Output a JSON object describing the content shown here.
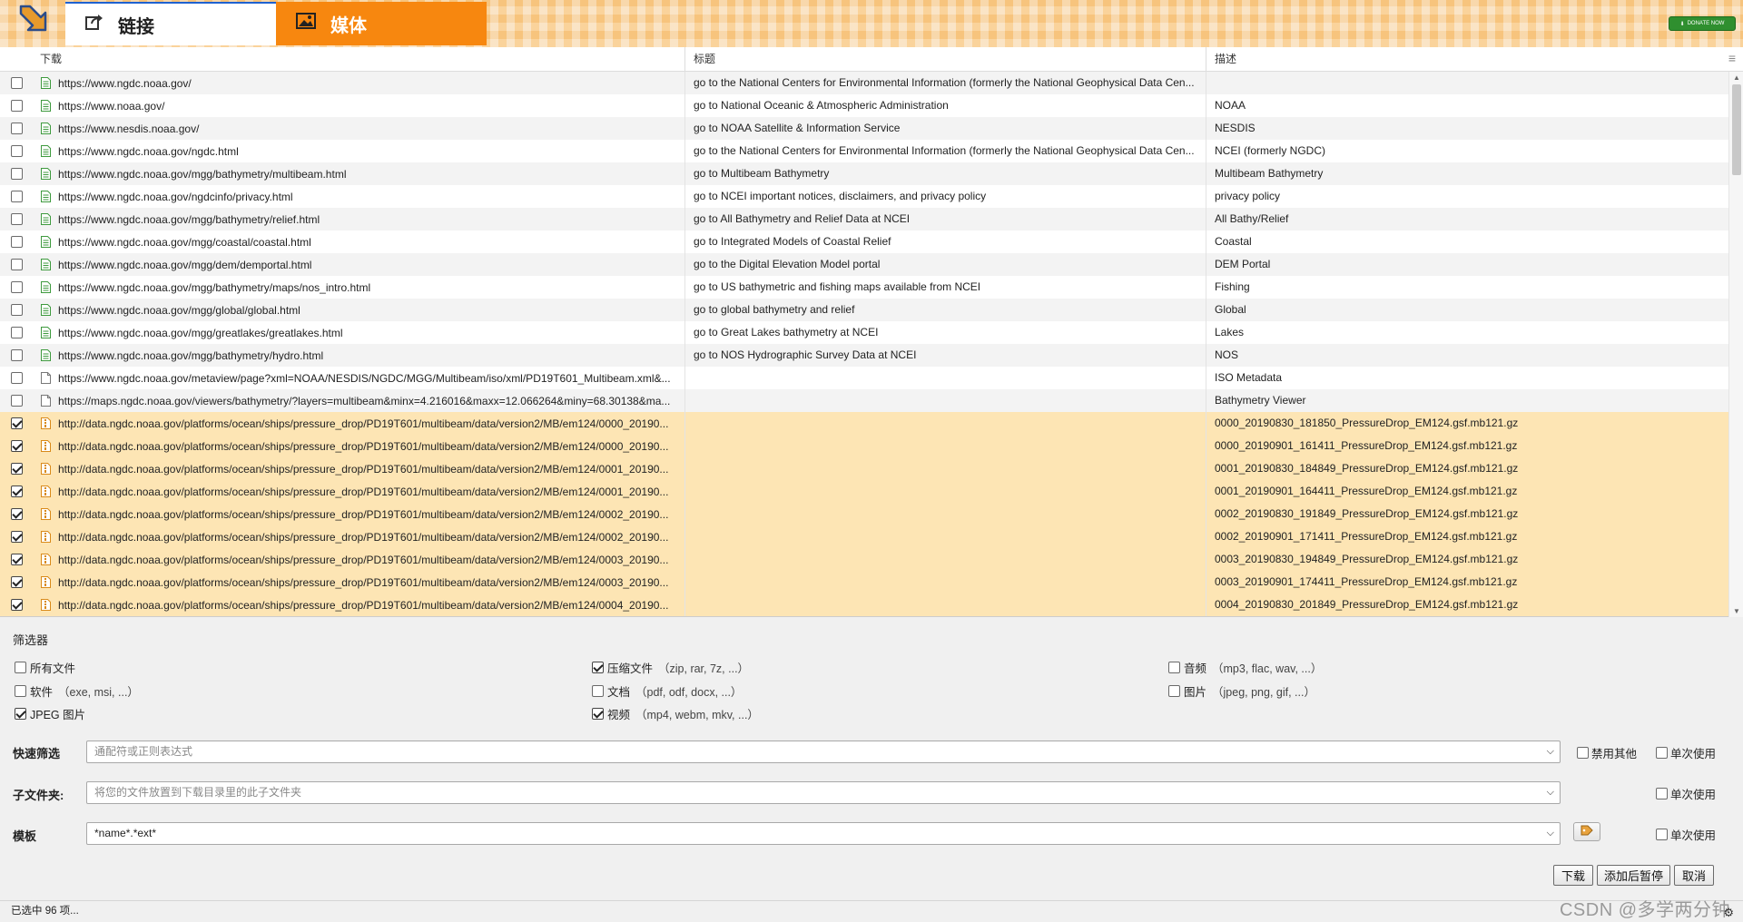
{
  "tabs": [
    {
      "label": "链接",
      "icon": "share-icon",
      "active": true
    },
    {
      "label": "媒体",
      "icon": "image-icon",
      "active": false
    }
  ],
  "donate_label": "DONATE NOW",
  "table": {
    "headers": {
      "url": "下载",
      "title": "标题",
      "desc": "描述"
    },
    "rows": [
      {
        "checked": false,
        "icon": "page-icon",
        "url": "https://www.ngdc.noaa.gov/",
        "title": "go to the National Centers for Environmental Information (formerly the National Geophysical Data Cen...",
        "desc": ""
      },
      {
        "checked": false,
        "icon": "page-icon",
        "url": "https://www.noaa.gov/",
        "title": "go to National Oceanic & Atmospheric Administration",
        "desc": "NOAA"
      },
      {
        "checked": false,
        "icon": "page-icon",
        "url": "https://www.nesdis.noaa.gov/",
        "title": "go to NOAA Satellite & Information Service",
        "desc": "NESDIS"
      },
      {
        "checked": false,
        "icon": "page-icon",
        "url": "https://www.ngdc.noaa.gov/ngdc.html",
        "title": "go to the National Centers for Environmental Information (formerly the National Geophysical Data Cen...",
        "desc": "NCEI (formerly NGDC)"
      },
      {
        "checked": false,
        "icon": "page-icon",
        "url": "https://www.ngdc.noaa.gov/mgg/bathymetry/multibeam.html",
        "title": "go to Multibeam Bathymetry",
        "desc": "Multibeam Bathymetry"
      },
      {
        "checked": false,
        "icon": "page-icon",
        "url": "https://www.ngdc.noaa.gov/ngdcinfo/privacy.html",
        "title": "go to NCEI important notices, disclaimers, and privacy policy",
        "desc": "privacy policy"
      },
      {
        "checked": false,
        "icon": "page-icon",
        "url": "https://www.ngdc.noaa.gov/mgg/bathymetry/relief.html",
        "title": "go to All Bathymetry and Relief Data at NCEI",
        "desc": "All Bathy/Relief"
      },
      {
        "checked": false,
        "icon": "page-icon",
        "url": "https://www.ngdc.noaa.gov/mgg/coastal/coastal.html",
        "title": "go to Integrated Models of Coastal Relief",
        "desc": "Coastal"
      },
      {
        "checked": false,
        "icon": "page-icon",
        "url": "https://www.ngdc.noaa.gov/mgg/dem/demportal.html",
        "title": "go to the Digital Elevation Model portal",
        "desc": "DEM Portal"
      },
      {
        "checked": false,
        "icon": "page-icon",
        "url": "https://www.ngdc.noaa.gov/mgg/bathymetry/maps/nos_intro.html",
        "title": "go to US bathymetric and fishing maps available from NCEI",
        "desc": "Fishing"
      },
      {
        "checked": false,
        "icon": "page-icon",
        "url": "https://www.ngdc.noaa.gov/mgg/global/global.html",
        "title": "go to global bathymetry and relief",
        "desc": "Global"
      },
      {
        "checked": false,
        "icon": "page-icon",
        "url": "https://www.ngdc.noaa.gov/mgg/greatlakes/greatlakes.html",
        "title": "go to Great Lakes bathymetry at NCEI",
        "desc": "Lakes"
      },
      {
        "checked": false,
        "icon": "page-icon",
        "url": "https://www.ngdc.noaa.gov/mgg/bathymetry/hydro.html",
        "title": "go to NOS Hydrographic Survey Data at NCEI",
        "desc": "NOS"
      },
      {
        "checked": false,
        "icon": "blank-file-icon",
        "url": "https://www.ngdc.noaa.gov/metaview/page?xml=NOAA/NESDIS/NGDC/MGG/Multibeam/iso/xml/PD19T601_Multibeam.xml&...",
        "title": "",
        "desc": "ISO Metadata"
      },
      {
        "checked": false,
        "icon": "blank-file-icon",
        "url": "https://maps.ngdc.noaa.gov/viewers/bathymetry/?layers=multibeam&minx=4.216016&maxx=12.066264&miny=68.30138&ma...",
        "title": "",
        "desc": "Bathymetry Viewer"
      },
      {
        "checked": true,
        "icon": "archive-file-icon",
        "url": "http://data.ngdc.noaa.gov/platforms/ocean/ships/pressure_drop/PD19T601/multibeam/data/version2/MB/em124/0000_20190...",
        "title": "",
        "desc": "0000_20190830_181850_PressureDrop_EM124.gsf.mb121.gz"
      },
      {
        "checked": true,
        "icon": "archive-file-icon",
        "url": "http://data.ngdc.noaa.gov/platforms/ocean/ships/pressure_drop/PD19T601/multibeam/data/version2/MB/em124/0000_20190...",
        "title": "",
        "desc": "0000_20190901_161411_PressureDrop_EM124.gsf.mb121.gz"
      },
      {
        "checked": true,
        "icon": "archive-file-icon",
        "url": "http://data.ngdc.noaa.gov/platforms/ocean/ships/pressure_drop/PD19T601/multibeam/data/version2/MB/em124/0001_20190...",
        "title": "",
        "desc": "0001_20190830_184849_PressureDrop_EM124.gsf.mb121.gz"
      },
      {
        "checked": true,
        "icon": "archive-file-icon",
        "url": "http://data.ngdc.noaa.gov/platforms/ocean/ships/pressure_drop/PD19T601/multibeam/data/version2/MB/em124/0001_20190...",
        "title": "",
        "desc": "0001_20190901_164411_PressureDrop_EM124.gsf.mb121.gz"
      },
      {
        "checked": true,
        "icon": "archive-file-icon",
        "url": "http://data.ngdc.noaa.gov/platforms/ocean/ships/pressure_drop/PD19T601/multibeam/data/version2/MB/em124/0002_20190...",
        "title": "",
        "desc": "0002_20190830_191849_PressureDrop_EM124.gsf.mb121.gz"
      },
      {
        "checked": true,
        "icon": "archive-file-icon",
        "url": "http://data.ngdc.noaa.gov/platforms/ocean/ships/pressure_drop/PD19T601/multibeam/data/version2/MB/em124/0002_20190...",
        "title": "",
        "desc": "0002_20190901_171411_PressureDrop_EM124.gsf.mb121.gz"
      },
      {
        "checked": true,
        "icon": "archive-file-icon",
        "url": "http://data.ngdc.noaa.gov/platforms/ocean/ships/pressure_drop/PD19T601/multibeam/data/version2/MB/em124/0003_20190...",
        "title": "",
        "desc": "0003_20190830_194849_PressureDrop_EM124.gsf.mb121.gz"
      },
      {
        "checked": true,
        "icon": "archive-file-icon",
        "url": "http://data.ngdc.noaa.gov/platforms/ocean/ships/pressure_drop/PD19T601/multibeam/data/version2/MB/em124/0003_20190...",
        "title": "",
        "desc": "0003_20190901_174411_PressureDrop_EM124.gsf.mb121.gz"
      },
      {
        "checked": true,
        "icon": "archive-file-icon",
        "url": "http://data.ngdc.noaa.gov/platforms/ocean/ships/pressure_drop/PD19T601/multibeam/data/version2/MB/em124/0004_20190...",
        "title": "",
        "desc": "0004_20190830_201849_PressureDrop_EM124.gsf.mb121.gz"
      }
    ]
  },
  "filters": {
    "title": "筛选器",
    "items": [
      {
        "label": "所有文件",
        "ext": "",
        "checked": false
      },
      {
        "label": "压缩文件",
        "ext": "（zip, rar, 7z, ...）",
        "checked": true
      },
      {
        "label": "音频",
        "ext": "（mp3, flac, wav, ...）",
        "checked": false
      },
      {
        "label": "软件",
        "ext": "（exe, msi, ...）",
        "checked": false
      },
      {
        "label": "文档",
        "ext": "（pdf, odf, docx, ...）",
        "checked": false
      },
      {
        "label": "图片",
        "ext": "（jpeg, png, gif, ...）",
        "checked": false
      },
      {
        "label": "JPEG 图片",
        "ext": "",
        "checked": true
      },
      {
        "label": "视频",
        "ext": "（mp4, webm, mkv, ...）",
        "checked": true
      }
    ]
  },
  "quick_filter": {
    "label": "快速筛选",
    "placeholder": "通配符或正则表达式",
    "disable_others": "禁用其他",
    "once": "单次使用"
  },
  "subfolder": {
    "label": "子文件夹:",
    "placeholder": "将您的文件放置到下载目录里的此子文件夹",
    "once": "单次使用"
  },
  "mask": {
    "label": "模板",
    "value": "*name*.*ext*",
    "once": "单次使用"
  },
  "buttons": {
    "download": "下载",
    "add_paused": "添加后暂停",
    "cancel": "取消"
  },
  "status": "已选中 96 项...",
  "watermark": "CSDN @多学两分钟",
  "colors": {
    "accent_tab": "#f7870f",
    "checked_row": "#fde5b4",
    "active_tab_border": "#1e62d0"
  }
}
